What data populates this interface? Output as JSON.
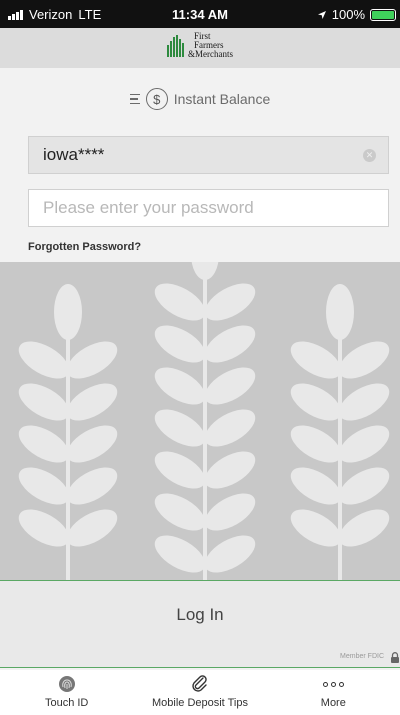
{
  "status_bar": {
    "carrier": "Verizon",
    "network": "LTE",
    "time": "11:34 AM",
    "battery": "100%",
    "battery_level": 1.0
  },
  "header": {
    "logo_lines": [
      "First",
      "Farmers",
      "&Merchants"
    ],
    "brand_color": "#2d8a3e"
  },
  "balance": {
    "label": "Instant Balance",
    "icon": "dollar-circle-icon"
  },
  "login_form": {
    "username_value": "iowa****",
    "password_placeholder": "Please enter your password",
    "forgot_link": "Forgotten Password?",
    "login_button": "Log In"
  },
  "footer": {
    "fdic": "Member FDIC",
    "accent_color": "#5aa864"
  },
  "tabbar": {
    "items": [
      {
        "label": "Touch ID",
        "icon": "fingerprint-icon"
      },
      {
        "label": "Mobile Deposit Tips",
        "icon": "paperclip-icon"
      },
      {
        "label": "More",
        "icon": "more-dots-icon"
      }
    ]
  }
}
